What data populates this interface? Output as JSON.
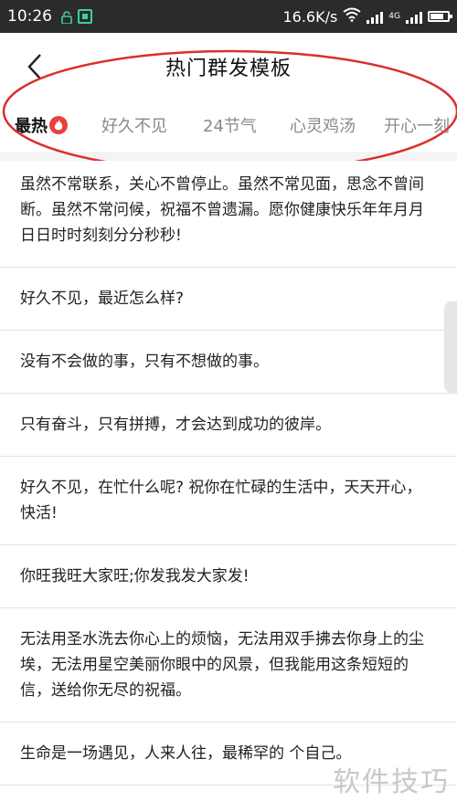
{
  "status_bar": {
    "time": "10:26",
    "net_speed": "16.6K/s",
    "network": "4G"
  },
  "header": {
    "title": "热门群发模板"
  },
  "tabs": [
    {
      "label": "最热",
      "active": true
    },
    {
      "label": "好久不见",
      "active": false
    },
    {
      "label": "24节气",
      "active": false
    },
    {
      "label": "心灵鸡汤",
      "active": false
    },
    {
      "label": "开心一刻",
      "active": false
    }
  ],
  "messages": [
    {
      "text": "虽然不常联系，关心不曾停止。虽然不常见面，思念不曾间断。虽然不常问候，祝福不曾遗漏。愿你健康快乐年年月月日日时时刻刻分分秒秒!"
    },
    {
      "text": "好久不见，最近怎么样?"
    },
    {
      "text": "没有不会做的事，只有不想做的事。"
    },
    {
      "text": "只有奋斗，只有拼搏，才会达到成功的彼岸。"
    },
    {
      "text": "好久不见，在忙什么呢? 祝你在忙碌的生活中，天天开心，快活!"
    },
    {
      "text": "你旺我旺大家旺;你发我发大家发!"
    },
    {
      "text": "无法用圣水洗去你心上的烦恼，无法用双手拂去你身上的尘埃，无法用星空美丽你眼中的风景，但我能用这条短短的信，送给你无尽的祝福。"
    },
    {
      "text": "生命是一场遇见，人来人往，最稀罕的 个自己。"
    }
  ],
  "watermark": "软件技巧",
  "colors": {
    "annotation_ellipse": "#d9302c",
    "fire_badge": "#e8413c"
  }
}
